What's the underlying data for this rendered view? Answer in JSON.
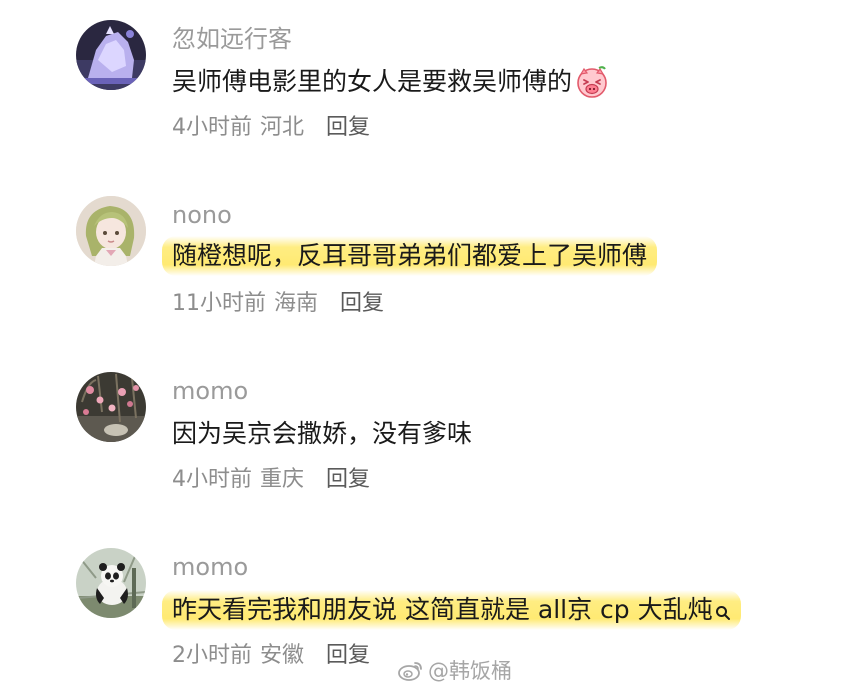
{
  "comments": [
    {
      "username": "忽如远行客",
      "text": "吴师傅电影里的女人是要救吴师傅的",
      "time": "4小时前",
      "location": "河北",
      "reply_label": "回复",
      "emoji": "pig-face-emoji",
      "highlighted": false
    },
    {
      "username": "nono",
      "text": "随橙想呢，反耳哥哥弟弟们都爱上了吴师傅",
      "time": "11小时前",
      "location": "海南",
      "reply_label": "回复",
      "highlighted": true
    },
    {
      "username": "momo",
      "text": "因为吴京会撒娇，没有爹味",
      "time": "4小时前",
      "location": "重庆",
      "reply_label": "回复",
      "highlighted": false
    },
    {
      "username": "momo",
      "text": "昨天看完我和朋友说 这简直就是 all京 cp 大乱炖",
      "time": "2小时前",
      "location": "安徽",
      "reply_label": "回复",
      "trailing_icon": "search-icon",
      "highlighted": true
    }
  ],
  "watermark": {
    "text": "@韩饭桶",
    "icon": "weibo-logo"
  },
  "colors": {
    "highlight": "#ffe85f",
    "username": "#9a9a9a",
    "meta": "#8d8d8d",
    "text": "#1a1a1a"
  }
}
